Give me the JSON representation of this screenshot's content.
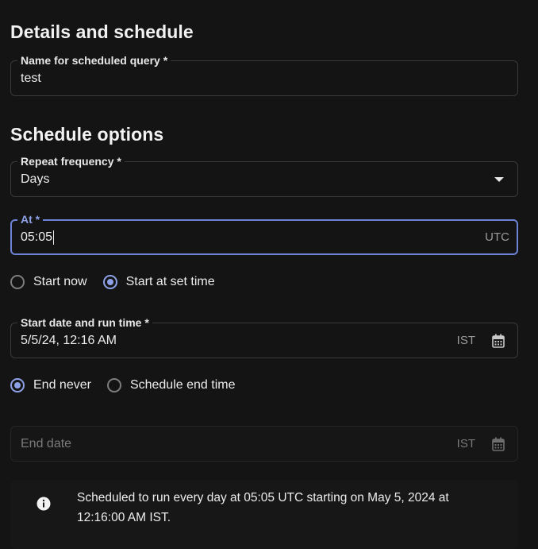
{
  "details": {
    "heading": "Details and schedule",
    "name_label": "Name for scheduled query *",
    "name_value": "test"
  },
  "schedule": {
    "heading": "Schedule options",
    "frequency_label": "Repeat frequency *",
    "frequency_value": "Days",
    "at_label": "At *",
    "at_value": "05:05",
    "at_suffix": "UTC",
    "start_options": [
      {
        "label": "Start now",
        "checked": false
      },
      {
        "label": "Start at set time",
        "checked": true
      }
    ],
    "start_label": "Start date and run time *",
    "start_value": "5/5/24, 12:16 AM",
    "start_suffix": "IST",
    "end_options": [
      {
        "label": "End never",
        "checked": true
      },
      {
        "label": "Schedule end time",
        "checked": false
      }
    ],
    "end_placeholder": "End date",
    "end_suffix": "IST"
  },
  "info": {
    "icon": "info-icon",
    "text": "Scheduled to run every day at 05:05 UTC starting on May 5, 2024 at 12:16:00 AM IST."
  },
  "colors": {
    "background": "#141414",
    "accent": "#8ea1e6",
    "border": "#3a3a3a"
  }
}
